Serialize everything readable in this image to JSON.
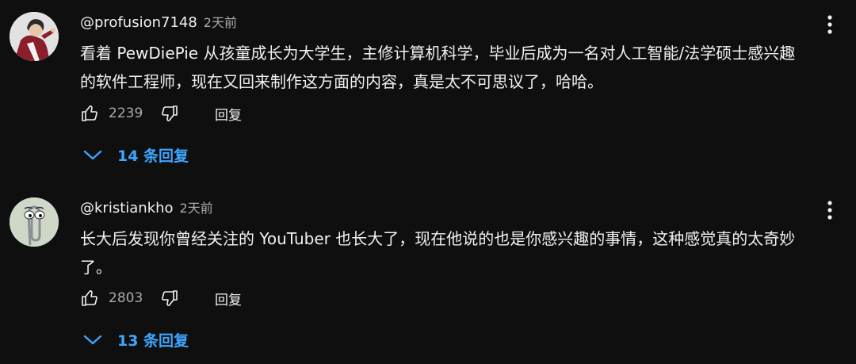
{
  "comments": [
    {
      "author": "@profusion7148",
      "time": "2天前",
      "text_line1": "看着 PewDiePie 从孩童成长为大学生，主修计算机科学，毕业后成为一名对人工智能/法学硕士感兴趣",
      "text_line2": "的软件工程师，现在又回来制作这方面的内容，真是太不可思议了，哈哈。",
      "likes": "2239",
      "reply_label": "回复",
      "replies_label": "14 条回复",
      "avatar_icon": "cartoon-character-avatar"
    },
    {
      "author": "@kristiankho",
      "time": "2天前",
      "text_line1": "长大后发现你曾经关注的 YouTuber 也长大了，现在他说的也是你感兴趣的事情，这种感觉真的太奇妙",
      "text_line2": "了。",
      "likes": "2803",
      "reply_label": "回复",
      "replies_label": "13 条回复",
      "avatar_icon": "paperclip-avatar"
    }
  ],
  "colors": {
    "background": "#0f0f0f",
    "text": "#f1f1f1",
    "muted": "#aaaaaa",
    "link": "#3ea6ff"
  }
}
